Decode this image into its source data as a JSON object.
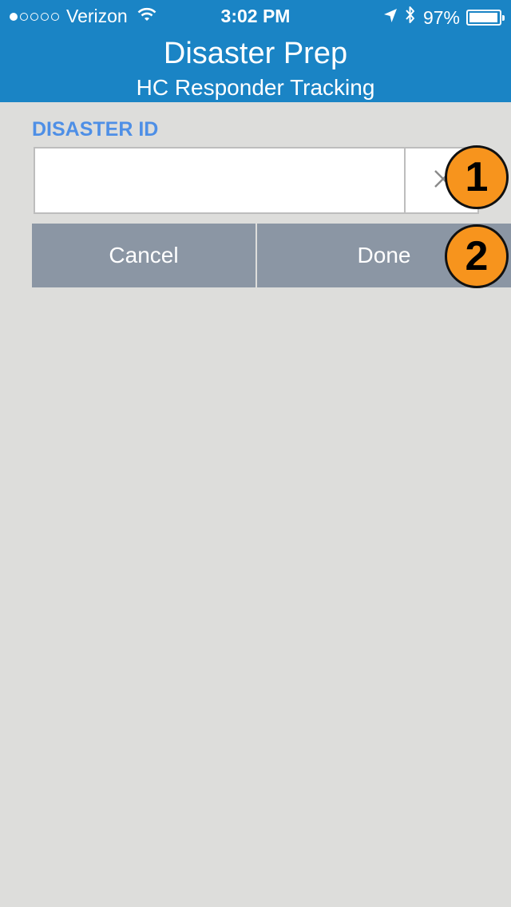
{
  "status_bar": {
    "signal_dots": [
      true,
      false,
      false,
      false,
      false
    ],
    "carrier": "Verizon",
    "wifi_icon": "wifi-icon",
    "time": "3:02 PM",
    "location_icon": "location-arrow-icon",
    "bluetooth_icon": "bluetooth-icon",
    "battery_percent": "97%",
    "battery_level": 0.97
  },
  "header": {
    "title": "Disaster Prep",
    "subtitle": "HC Responder Tracking",
    "background_color": "#1a84c5"
  },
  "form": {
    "field_label": "DISASTER ID",
    "field_value": "",
    "field_placeholder": "",
    "clear_icon": "clear-x-icon",
    "label_color": "#4e8fe6"
  },
  "buttons": {
    "cancel_label": "Cancel",
    "done_label": "Done",
    "button_color": "#8b96a4"
  },
  "callouts": [
    {
      "number": "1",
      "color": "#f7941d"
    },
    {
      "number": "2",
      "color": "#f7941d"
    }
  ]
}
